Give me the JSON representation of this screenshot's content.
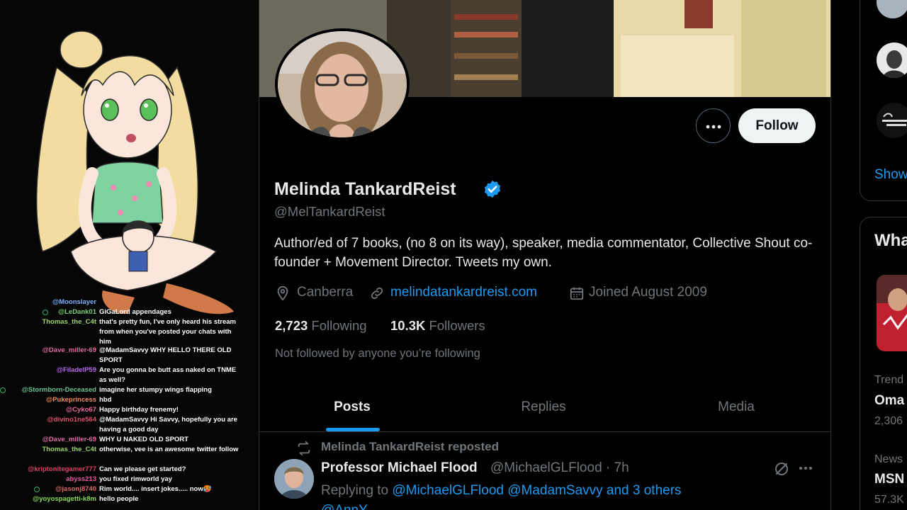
{
  "profile": {
    "display_name": "Melinda TankardReist",
    "handle": "@MelTankardReist",
    "bio": "Author/ed of 7 books, (no 8 on its way), speaker, media commentator, Collective Shout co-founder + Movement Director. Tweets my own.",
    "location": "Canberra",
    "website": "melindatankardreist.com",
    "joined": "Joined August 2009",
    "following_count": "2,723",
    "following_label": "Following",
    "followers_count": "10.3K",
    "followers_label": "Followers",
    "not_followed_note": "Not followed by anyone you’re following",
    "follow_button": "Follow",
    "more_icon": "more-horizontal-icon",
    "verified_icon": "verified-badge-icon",
    "accent_color": "#1d9bf0"
  },
  "tabs": [
    {
      "label": "Posts",
      "active": true
    },
    {
      "label": "Replies",
      "active": false
    },
    {
      "label": "Media",
      "active": false
    }
  ],
  "post": {
    "repost_label": "Melinda TankardReist reposted",
    "author": "Professor Michael Flood",
    "handle_time": "@MichaelGLFlood · 7h",
    "replying_prefix": "Replying to",
    "replying_to": "@MichaelGLFlood @MadamSavvy and 3 others",
    "text_preview": "@AnnY..."
  },
  "sidebar": {
    "show_more": "Show",
    "whats_happening": "Wha",
    "trends": [
      {
        "category": "Trend",
        "title": "Oma",
        "count": "2,306"
      },
      {
        "category": "News",
        "title": "MSN",
        "count": "57.3K"
      }
    ]
  },
  "chat": [
    {
      "user": "@Moonslayer",
      "msg": "",
      "color": "#7fb0ff",
      "icon": false
    },
    {
      "user": "@LeDank01",
      "msg": "GiGaLord appendages",
      "color": "#7ad17a",
      "icon": true
    },
    {
      "user": "Thomas_the_C4t",
      "msg": "that's pretty fun, I've only heard his stream from when you've posted your chats with him",
      "color": "#9cd36a",
      "icon": false
    },
    {
      "user": "@Dave_miller-69",
      "msg": "@MadamSavvy WHY HELLO THERE OLD SPORT",
      "color": "#e46aa8",
      "icon": false
    },
    {
      "user": "@FiladelP59",
      "msg": "Are you gonna be butt ass naked on TNME as well?",
      "color": "#b86af0",
      "icon": false
    },
    {
      "user": "@Stormborn-Deceased",
      "msg": "imagine her stumpy wings flapping",
      "color": "#6ac38f",
      "icon": true
    },
    {
      "user": "@Pukeprincess",
      "msg": "hbd",
      "color": "#f08a5a",
      "icon": false
    },
    {
      "user": "@Cyko67",
      "msg": "Happy birthday frenemy!",
      "color": "#f06aa0",
      "icon": false
    },
    {
      "user": "@divino1ne564",
      "msg": "@MadamSavvy Hi Savvy, hopefully you are having a good day",
      "color": "#e0556a",
      "icon": false
    },
    {
      "user": "@Dave_miller-69",
      "msg": "WHY U NAKED OLD SPORT",
      "color": "#e46aa8",
      "icon": false
    },
    {
      "user": "Thomas_the_C4t",
      "msg": "otherwise, vee is an awesome twitter follow",
      "color": "#9cd36a",
      "icon": false
    },
    {
      "user": "@kriptonitegamer777",
      "msg": "Can we please get started?",
      "color": "#e0406a",
      "icon": false
    },
    {
      "user": "abyss213",
      "msg": "you fixed rimworld yay",
      "color": "#e85aa0",
      "icon": false
    },
    {
      "user": "@jasonj8740",
      "msg": "Rim world.... insert jokes..... now🥵",
      "color": "#e06a6a",
      "icon": true
    },
    {
      "user": "@yoyospagetti-k8m",
      "msg": "hello people",
      "color": "#8adc5a",
      "icon": false
    }
  ]
}
